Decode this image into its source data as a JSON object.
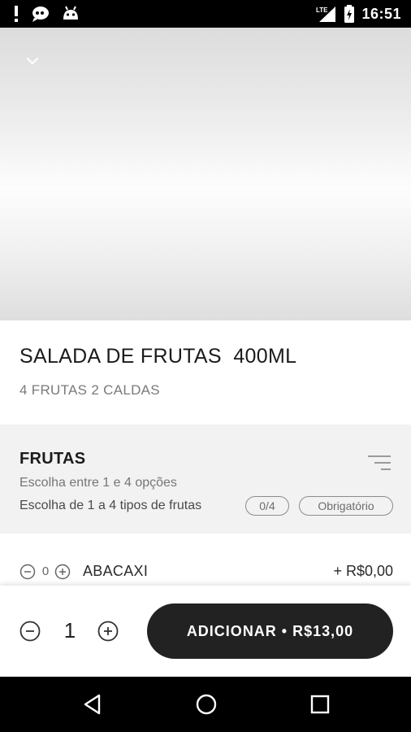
{
  "status_bar": {
    "time": "16:51",
    "network_label": "LTE",
    "left_icons": [
      "alert-icon",
      "notification-icon",
      "android-icon"
    ],
    "right_icons": [
      "signal-icon",
      "battery-charging-icon"
    ]
  },
  "hero": {
    "collapse_icon": "chevron-down-icon"
  },
  "product": {
    "title": "SALADA DE FRUTAS  400ML",
    "subtitle": "4 FRUTAS 2 CALDAS"
  },
  "group": {
    "title": "FRUTAS",
    "choose_text": "Escolha entre 1 e 4 opções",
    "description": "Escolha de 1 a 4 tipos de frutas",
    "selected_count": "0/4",
    "required_label": "Obrigatório",
    "filter_icon": "filter-icon"
  },
  "options": [
    {
      "name": "ABACAXI",
      "quantity": "0",
      "price": "+ R$0,00"
    }
  ],
  "cart": {
    "quantity": "1",
    "add_label": "ADICIONAR • R$13,00"
  },
  "nav_bar": {
    "icons": [
      "back-icon",
      "home-icon",
      "recent-apps-icon"
    ]
  },
  "colors": {
    "primary_button": "#222222",
    "section_background": "#f2f2f2",
    "text_dark": "#1b1b1b",
    "text_muted": "#7a7a7a"
  }
}
